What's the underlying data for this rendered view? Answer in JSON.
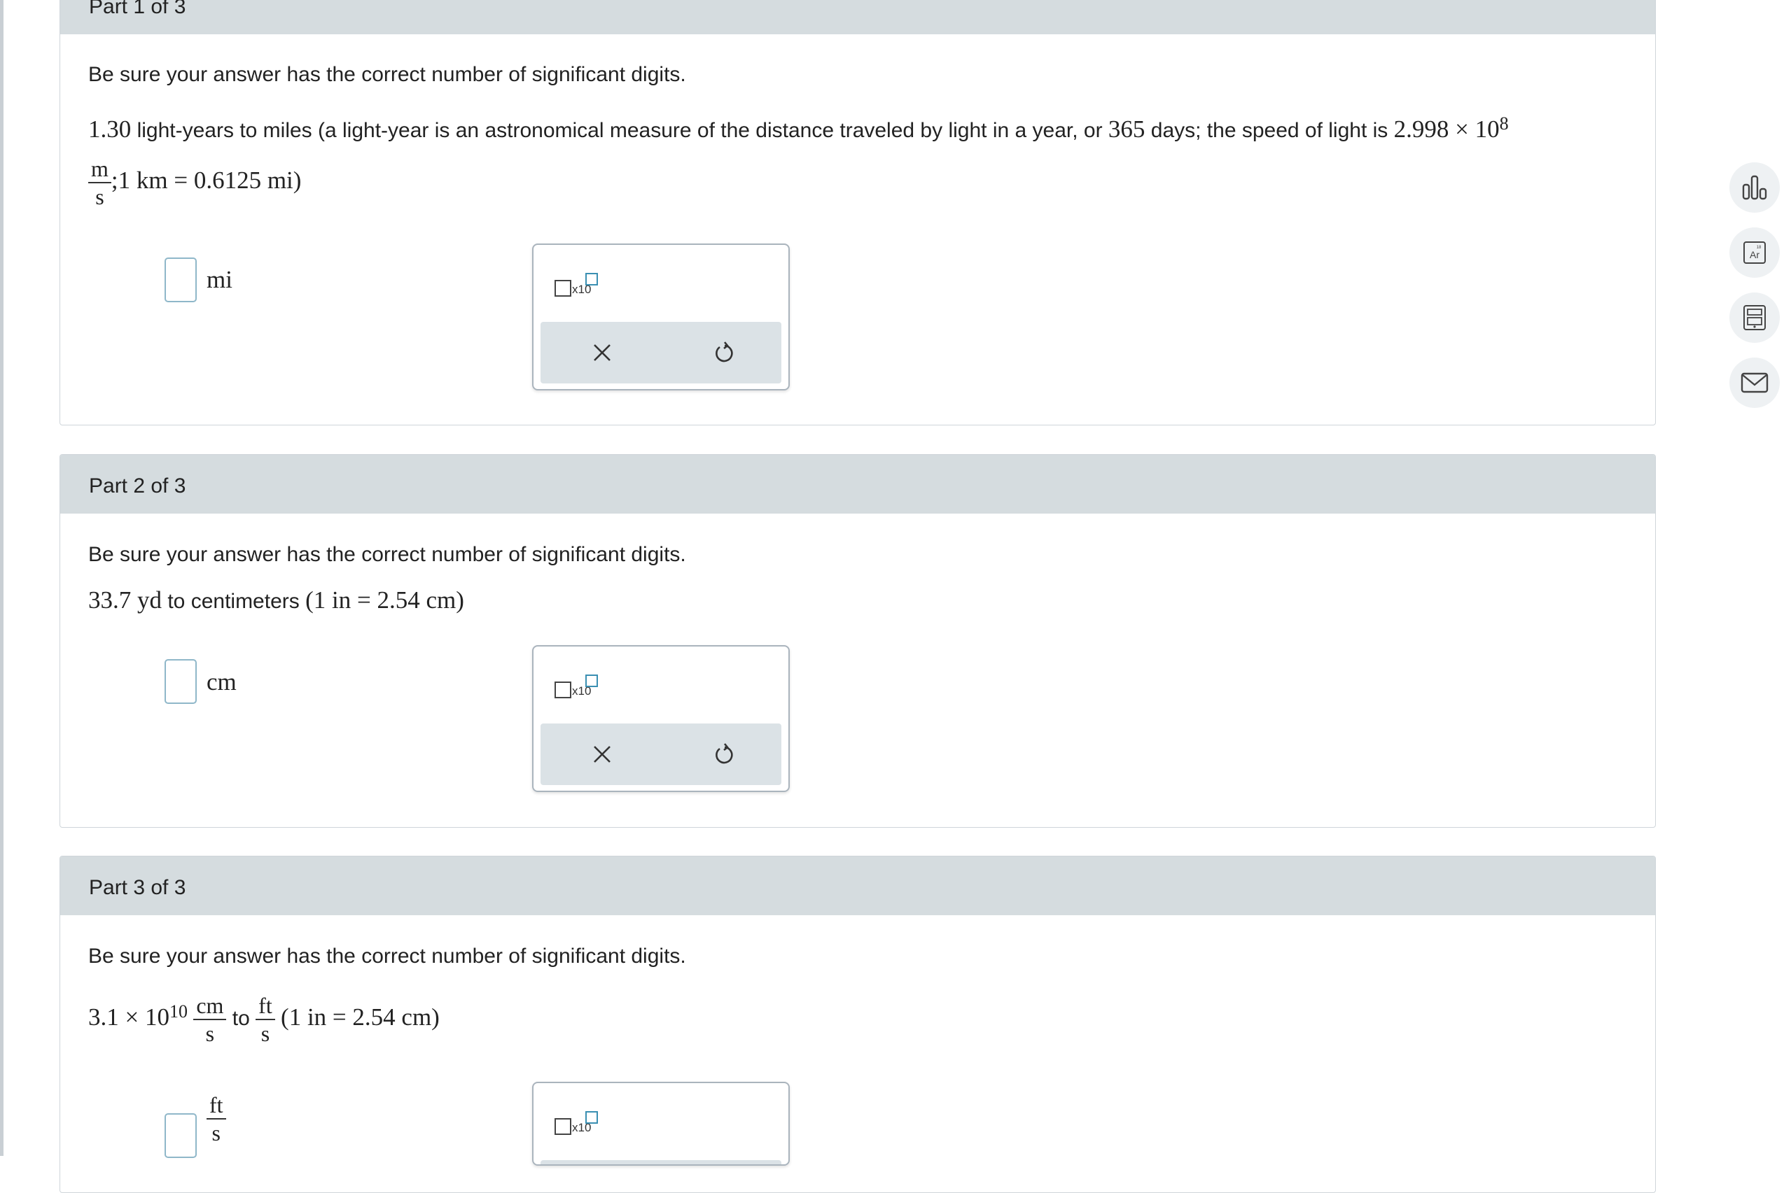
{
  "part1": {
    "label": "Part 1 of 3",
    "instruction": "Be sure your answer has the correct number of significant digits.",
    "q_value": "1.30",
    "q_text_a": "light-years to miles (a light-year is an astronomical measure of the distance traveled by light in a year, or",
    "q_days": "365",
    "q_text_b": "days; the speed of light is",
    "q_speed": "2.998 × 10",
    "q_speed_exp": "8",
    "q_frac_num": "m",
    "q_frac_den": "s",
    "q_conv": ";1 km = 0.6125 mi)",
    "unit": "mi"
  },
  "part2": {
    "label": "Part 2 of 3",
    "instruction": "Be sure your answer has the correct number of significant digits.",
    "q_value": "33.7 yd",
    "q_text": "to centimeters",
    "q_conv": "(1 in = 2.54 cm)",
    "unit": "cm"
  },
  "part3": {
    "label": "Part 3 of 3",
    "instruction": "Be sure your answer has the correct number of significant digits.",
    "q_value": "3.1 × 10",
    "q_exp": "10",
    "q_frac1_num": "cm",
    "q_frac1_den": "s",
    "q_to": "to",
    "q_frac2_num": "ft",
    "q_frac2_den": "s",
    "q_conv": "(1 in = 2.54 cm)",
    "unit_num": "ft",
    "unit_den": "s"
  },
  "panel": {
    "sci_label": "x10"
  },
  "icons": [
    "bar-chart-icon",
    "periodic-table-icon",
    "calculator-icon",
    "mail-icon",
    "close-icon",
    "undo-icon"
  ],
  "colors": {
    "header_bg": "#d5dcdf",
    "accent": "#3a8fb2",
    "input_border": "#8fb7c9"
  }
}
